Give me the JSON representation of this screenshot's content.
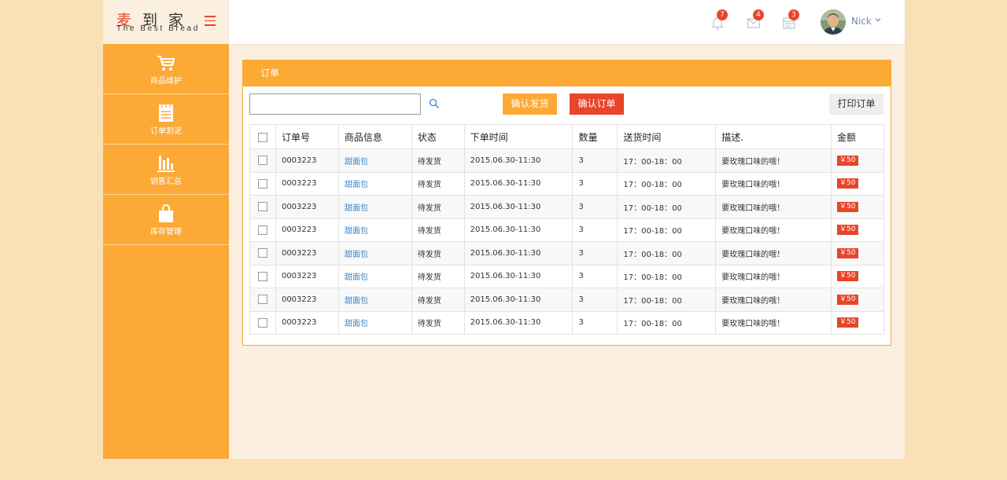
{
  "brand": {
    "name_first": "麦",
    "name_rest": "到家",
    "tagline": "The Best Bread"
  },
  "sidebar": {
    "items": [
      {
        "label": "商品维护",
        "icon": "cart-icon"
      },
      {
        "label": "订单割泥",
        "icon": "notepad-icon"
      },
      {
        "label": "销售汇总",
        "icon": "bar-chart-icon"
      },
      {
        "label": "库存管理",
        "icon": "shopping-bag-icon"
      }
    ]
  },
  "header": {
    "notifications": {
      "icon": "bell-icon",
      "count": "7"
    },
    "messages": {
      "icon": "mail-icon",
      "count": "4"
    },
    "calendar": {
      "icon": "calendar-icon",
      "count": "3"
    },
    "user": {
      "name": "Nick"
    }
  },
  "panel": {
    "title": "订单",
    "search": {
      "value": "",
      "placeholder": ""
    },
    "buttons": {
      "ship": "确认发货",
      "confirm": "确认订单",
      "print": "打印订单"
    }
  },
  "table": {
    "headers": [
      "订单号",
      "商品信息",
      "状态",
      "下单时间",
      "数量",
      "送货时间",
      "描述.",
      "金额"
    ],
    "rows": [
      {
        "order_no": "0003223",
        "product": "甜面包",
        "status": "待发货",
        "time": "2015.06.30-11:30",
        "qty": "3",
        "delivery": "17：00-18：00",
        "desc": "要玫瑰口味的哦！",
        "amount": "￥50"
      },
      {
        "order_no": "0003223",
        "product": "甜面包",
        "status": "待发货",
        "time": "2015.06.30-11:30",
        "qty": "3",
        "delivery": "17：00-18：00",
        "desc": "要玫瑰口味的哦！",
        "amount": "￥50"
      },
      {
        "order_no": "0003223",
        "product": "甜面包",
        "status": "待发货",
        "time": "2015.06.30-11:30",
        "qty": "3",
        "delivery": "17：00-18：00",
        "desc": "要玫瑰口味的哦！",
        "amount": "￥50"
      },
      {
        "order_no": "0003223",
        "product": "甜面包",
        "status": "待发货",
        "time": "2015.06.30-11:30",
        "qty": "3",
        "delivery": "17：00-18：00",
        "desc": "要玫瑰口味的哦！",
        "amount": "￥50"
      },
      {
        "order_no": "0003223",
        "product": "甜面包",
        "status": "待发货",
        "time": "2015.06.30-11:30",
        "qty": "3",
        "delivery": "17：00-18：00",
        "desc": "要玫瑰口味的哦！",
        "amount": "￥50"
      },
      {
        "order_no": "0003223",
        "product": "甜面包",
        "status": "待发货",
        "time": "2015.06.30-11:30",
        "qty": "3",
        "delivery": "17：00-18：00",
        "desc": "要玫瑰口味的哦！",
        "amount": "￥50"
      },
      {
        "order_no": "0003223",
        "product": "甜面包",
        "status": "待发货",
        "time": "2015.06.30-11:30",
        "qty": "3",
        "delivery": "17：00-18：00",
        "desc": "要玫瑰口味的哦！",
        "amount": "￥50"
      },
      {
        "order_no": "0003223",
        "product": "甜面包",
        "status": "待发货",
        "time": "2015.06.30-11:30",
        "qty": "3",
        "delivery": "17：00-18：00",
        "desc": "要玫瑰口味的哦！",
        "amount": "￥50"
      }
    ]
  },
  "colors": {
    "accent": "#fca936",
    "danger": "#e8452a",
    "page_bg": "#f9e0b6",
    "content_bg": "#fbefdf",
    "link": "#3a87c8"
  }
}
